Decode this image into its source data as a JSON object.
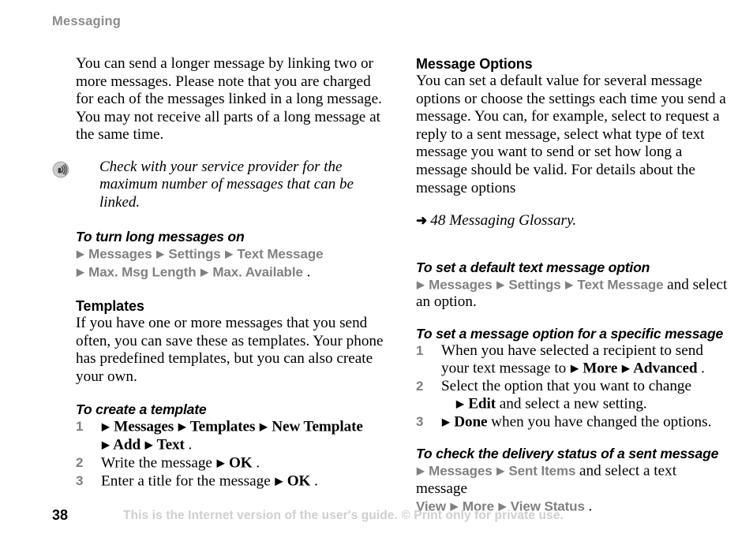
{
  "header": {
    "running_title": "Messaging"
  },
  "left_column": {
    "intro_paragraph": "You can send a longer message by linking two or more messages. Please note that you are charged for each of the messages linked in a long message. You may not receive all parts of a long message at the same time.",
    "note": {
      "icon": "signal-wave-icon",
      "text": "Check with your service provider for the maximum number of messages that can be linked."
    },
    "task_long_messages": {
      "heading": "To turn long messages on",
      "line1": [
        {
          "type": "arrow"
        },
        {
          "type": "menu",
          "text": "Messages"
        },
        {
          "type": "arrow"
        },
        {
          "type": "menu",
          "text": "Settings"
        },
        {
          "type": "arrow"
        },
        {
          "type": "menu",
          "text": "Text Message"
        }
      ],
      "line2": [
        {
          "type": "arrow"
        },
        {
          "type": "menu",
          "text": "Max. Msg Length"
        },
        {
          "type": "arrow"
        },
        {
          "type": "menu",
          "text": "Max. Available"
        },
        {
          "type": "serif",
          "text": "."
        }
      ]
    },
    "templates": {
      "heading": "Templates",
      "paragraph": "If you have one or more messages that you send often, you can save these as templates. Your phone has predefined templates, but you can also create your own."
    },
    "task_create_template": {
      "heading": "To create a template",
      "steps": [
        {
          "number": "1",
          "lines": [
            [
              {
                "type": "arrow"
              },
              {
                "type": "menu",
                "text": "Messages"
              },
              {
                "type": "arrow"
              },
              {
                "type": "menu",
                "text": "Templates"
              },
              {
                "type": "arrow"
              },
              {
                "type": "menu",
                "text": "New Template"
              }
            ],
            [
              {
                "type": "arrow"
              },
              {
                "type": "menu",
                "text": "Add"
              },
              {
                "type": "arrow"
              },
              {
                "type": "menu",
                "text": "Text"
              },
              {
                "type": "serif",
                "text": "."
              }
            ]
          ]
        },
        {
          "number": "2",
          "lines": [
            [
              {
                "type": "serif",
                "text": "Write the message "
              },
              {
                "type": "arrow"
              },
              {
                "type": "menu",
                "text": "OK"
              },
              {
                "type": "serif",
                "text": "."
              }
            ]
          ]
        },
        {
          "number": "3",
          "lines": [
            [
              {
                "type": "serif",
                "text": "Enter a title for the message "
              },
              {
                "type": "arrow"
              },
              {
                "type": "menu",
                "text": "OK"
              },
              {
                "type": "serif",
                "text": "."
              }
            ]
          ]
        }
      ]
    }
  },
  "right_column": {
    "message_options": {
      "heading": "Message Options",
      "paragraph": "You can set a default value for several message options or choose the settings each time you send a message. You can, for example, select to request a reply to a sent message, select what type of text message you want to send or set how long a message should be valid. For details about the message options",
      "cross_reference": {
        "arrow_glyph": "➜",
        "text": "48 Messaging Glossary."
      }
    },
    "task_default_option": {
      "heading": "To set a default text message option",
      "lines": [
        [
          {
            "type": "arrow"
          },
          {
            "type": "menu",
            "text": "Messages"
          },
          {
            "type": "arrow"
          },
          {
            "type": "menu",
            "text": "Settings"
          },
          {
            "type": "arrow"
          },
          {
            "type": "menu",
            "text": "Text Message"
          },
          {
            "type": "serif",
            "text": " and select"
          }
        ],
        [
          {
            "type": "serif",
            "text": "an option."
          }
        ]
      ]
    },
    "task_specific_message": {
      "heading": "To set a message option for a specific message",
      "steps": [
        {
          "number": "1",
          "lines": [
            [
              {
                "type": "serif",
                "text": "When you have selected a recipient to send"
              }
            ],
            [
              {
                "type": "serif",
                "text": "your text message to "
              },
              {
                "type": "arrow"
              },
              {
                "type": "menu",
                "text": "More"
              },
              {
                "type": "arrow"
              },
              {
                "type": "menu",
                "text": "Advanced"
              },
              {
                "type": "serif",
                "text": "."
              }
            ]
          ]
        },
        {
          "number": "2",
          "lines": [
            [
              {
                "type": "serif",
                "text": "Select the option that you want to change"
              }
            ],
            [
              {
                "type": "indent"
              },
              {
                "type": "arrow"
              },
              {
                "type": "menu",
                "text": "Edit"
              },
              {
                "type": "serif",
                "text": " and select a new setting."
              }
            ]
          ]
        },
        {
          "number": "3",
          "lines": [
            [
              {
                "type": "arrow"
              },
              {
                "type": "menu",
                "text": "Done"
              },
              {
                "type": "serif",
                "text": " when you have changed the options."
              }
            ]
          ]
        }
      ]
    },
    "task_delivery_status": {
      "heading": "To check the delivery status of a sent message",
      "lines": [
        [
          {
            "type": "arrow"
          },
          {
            "type": "menu",
            "text": "Messages"
          },
          {
            "type": "arrow"
          },
          {
            "type": "menu",
            "text": "Sent Items"
          },
          {
            "type": "serif",
            "text": " and select a text message"
          }
        ],
        [
          {
            "type": "menu",
            "text": "View"
          },
          {
            "type": "arrow"
          },
          {
            "type": "menu",
            "text": "More"
          },
          {
            "type": "arrow"
          },
          {
            "type": "menu",
            "text": "View Status"
          },
          {
            "type": "serif",
            "text": "."
          }
        ]
      ]
    }
  },
  "footer": {
    "page_number": "38",
    "notice": "This is the Internet version of the user's guide. © Print only for private use."
  },
  "colors": {
    "menu_gray": "#808080",
    "header_gray": "#8c8c8c",
    "footer_gray": "#cfcfcf",
    "body_black": "#000000"
  }
}
